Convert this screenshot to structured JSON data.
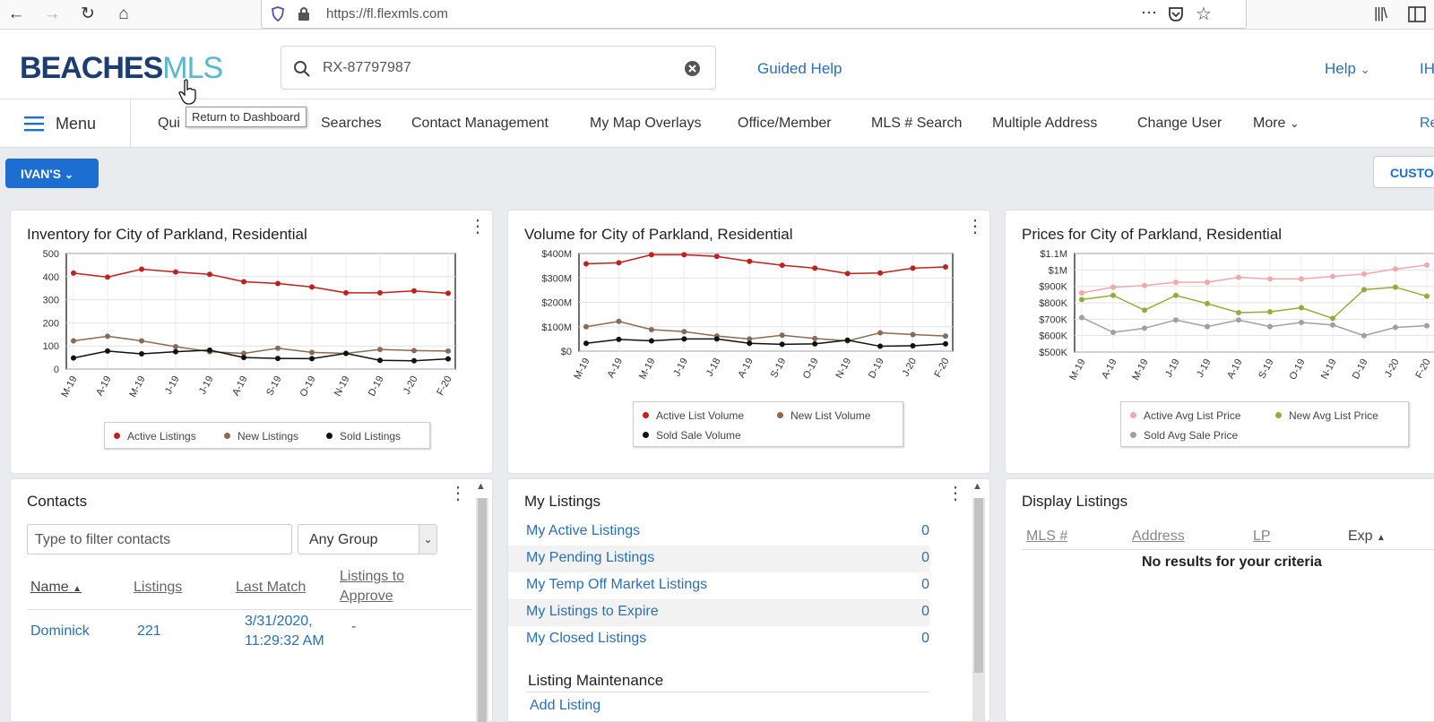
{
  "browser": {
    "url": "https://fl.flexmls.com"
  },
  "header": {
    "logo_left": "BEACHES",
    "logo_right": "MLS",
    "search_value": "RX-87797987",
    "guided_help": "Guided Help",
    "help": "Help",
    "user_initials": "IH"
  },
  "tooltip": "Return to Dashboard",
  "nav": {
    "menu": "Menu",
    "items": [
      "Qui",
      "Searches",
      "Contact Management",
      "My Map Overlays",
      "Office/Member",
      "MLS # Search",
      "Multiple Address",
      "Change User",
      "More"
    ],
    "right_edge": "Re"
  },
  "toolbar": {
    "dashboard_select": "IVAN'S",
    "customize": "CUSTO"
  },
  "colors": {
    "accent": "#1c6fd1",
    "link": "#2a6fb4",
    "active": "#c0211f",
    "new": "#8c6a4f",
    "sold": "#111111",
    "price_active": "#f2a7ad",
    "price_new": "#99aa3a",
    "price_sold": "#a0a0a0"
  },
  "chart_data": [
    {
      "type": "line",
      "title": "Inventory for City of Parkland, Residential",
      "categories": [
        "M-19",
        "A-19",
        "M-19",
        "J-19",
        "J-19",
        "A-19",
        "S-19",
        "O-19",
        "N-19",
        "D-19",
        "J-20",
        "F-20"
      ],
      "ylim": [
        0,
        500
      ],
      "yticks": [
        "0",
        "100",
        "200",
        "300",
        "400",
        "500"
      ],
      "series": [
        {
          "name": "Active Listings",
          "values": [
            415,
            398,
            432,
            420,
            410,
            378,
            370,
            355,
            330,
            330,
            338,
            328
          ]
        },
        {
          "name": "New Listings",
          "values": [
            122,
            142,
            122,
            97,
            75,
            68,
            90,
            72,
            68,
            85,
            80,
            78
          ]
        },
        {
          "name": "Sold Listings",
          "values": [
            48,
            78,
            66,
            75,
            82,
            50,
            46,
            45,
            68,
            38,
            36,
            44
          ]
        }
      ]
    },
    {
      "type": "line",
      "title": "Volume for City of Parkland, Residential",
      "categories": [
        "M-19",
        "A-19",
        "M-19",
        "J-19",
        "J-18",
        "A-19",
        "S-19",
        "O-19",
        "N-19",
        "D-19",
        "J-20",
        "F-20"
      ],
      "ylim": [
        0,
        400
      ],
      "yticks": [
        "$0",
        "$100M",
        "$200M",
        "$300M",
        "$400M"
      ],
      "series": [
        {
          "name": "Active List Volume",
          "values": [
            358,
            362,
            395,
            395,
            388,
            368,
            352,
            340,
            318,
            320,
            340,
            345
          ]
        },
        {
          "name": "New List Volume",
          "values": [
            100,
            122,
            88,
            80,
            62,
            50,
            65,
            52,
            42,
            75,
            68,
            62
          ]
        },
        {
          "name": "Sold Sale Volume",
          "values": [
            32,
            48,
            42,
            50,
            50,
            32,
            28,
            30,
            45,
            20,
            22,
            30
          ]
        }
      ]
    },
    {
      "type": "line",
      "title": "Prices for City of Parkland, Residential",
      "categories": [
        "M-19",
        "A-19",
        "M-19",
        "J-19",
        "J-19",
        "A-19",
        "S-19",
        "O-19",
        "N-19",
        "D-19",
        "J-20",
        "F-20"
      ],
      "ylim": [
        500,
        1100
      ],
      "yticks": [
        "$500K",
        "$600K",
        "$700K",
        "$800K",
        "$900K",
        "$1M",
        "$1.1M"
      ],
      "series": [
        {
          "name": "Active Avg List Price",
          "values": [
            860,
            895,
            905,
            925,
            925,
            955,
            945,
            945,
            960,
            975,
            1005,
            1030
          ]
        },
        {
          "name": "New Avg List Price",
          "values": [
            820,
            845,
            755,
            845,
            795,
            740,
            745,
            770,
            705,
            880,
            895,
            840
          ]
        },
        {
          "name": "Sold Avg Sale Price",
          "values": [
            710,
            620,
            645,
            695,
            655,
            695,
            655,
            680,
            665,
            600,
            650,
            660
          ]
        }
      ]
    }
  ],
  "contacts": {
    "title": "Contacts",
    "filter_placeholder": "Type to filter contacts",
    "group": "Any Group",
    "columns": [
      "Name",
      "Listings",
      "Last Match",
      "Listings to",
      "Approve"
    ],
    "rows": [
      {
        "name": "Dominick",
        "listings": "221",
        "last_match_1": "3/31/2020,",
        "last_match_2": "11:29:32 AM",
        "to_approve": "-"
      }
    ]
  },
  "my_listings": {
    "title": "My Listings",
    "items": [
      {
        "label": "My Active Listings",
        "count": "0"
      },
      {
        "label": "My Pending Listings",
        "count": "0"
      },
      {
        "label": "My Temp Off Market Listings",
        "count": "0"
      },
      {
        "label": "My Listings to Expire",
        "count": "0"
      },
      {
        "label": "My Closed Listings",
        "count": "0"
      }
    ],
    "maintenance_title": "Listing Maintenance",
    "add_listing": "Add Listing"
  },
  "display_listings": {
    "title": "Display Listings",
    "columns": [
      "MLS #",
      "Address",
      "LP",
      "Exp"
    ],
    "empty": "No results for your criteria"
  }
}
